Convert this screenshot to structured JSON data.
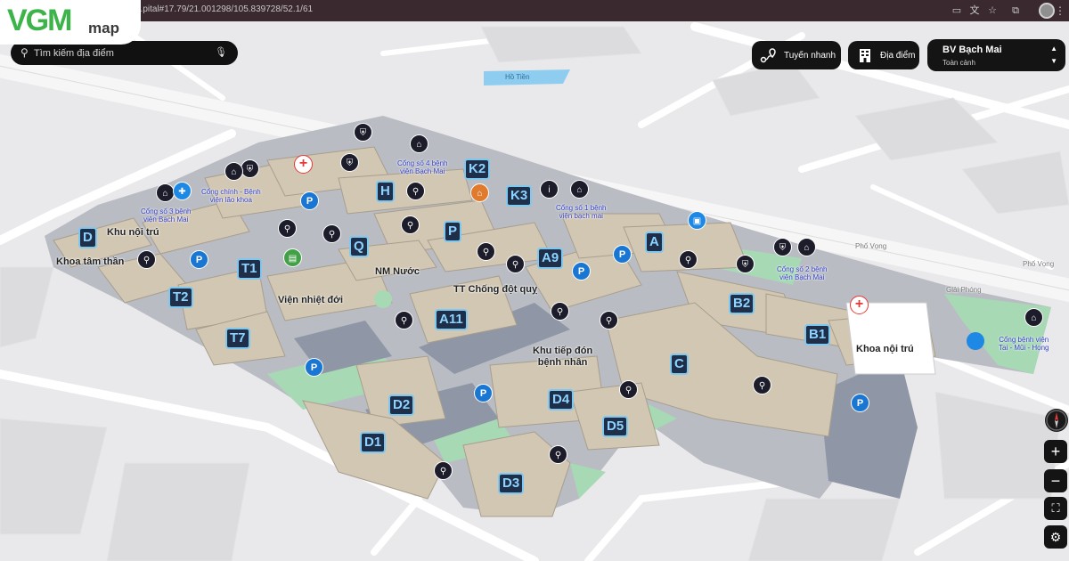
{
  "browser": {
    "url": "...pital#17.79/21.001298/105.839728/52.1/61"
  },
  "logo": {
    "mark": "VGM",
    "sub": "map"
  },
  "search": {
    "placeholder": "Tìm kiếm địa điểm"
  },
  "toolbar": {
    "route_label": "Tuyến nhanh",
    "places_label": "Địa điểm",
    "place_title": "BV Bạch Mai",
    "place_subtitle": "Toàn cảnh"
  },
  "controls": {
    "zoom_in": "+",
    "zoom_out": "−"
  },
  "map": {
    "streets": {
      "lake": "Hồ Tiền",
      "phuong_mai": "Phố Vọng",
      "phuong_mai_2": "Phố Vọng",
      "giai_phong": "Giải Phóng"
    },
    "areas": {
      "khu_noi_tru_left": "Khu nội trú",
      "khoa_tam_than": "Khoa tâm thần",
      "nm_nuoc": "NM Nước",
      "vien_nhiet_doi": "Viện nhiệt đới",
      "tt_chong_dot_quy": "TT Chống đột quỵ",
      "khu_tiep_don": "Khu tiếp đón\nbệnh nhân",
      "khoa_noi_tru_right": "Khoa nội trú"
    },
    "gates": {
      "cong_4": "Cổng số 4 bệnh\nviện Bạch Mai",
      "cong_chinh": "Cổng chính - Bệnh\nviện lão khoa",
      "cong_3": "Cổng số 3 bệnh\nviện Bạch Mai",
      "cong_1": "Cổng số 1 bệnh\nviện bạch mai",
      "cong_2": "Cổng số 2 bệnh\nviện Bạch Mai",
      "cong_tmh": "Cổng bệnh viện\nTai - Mũi - Họng"
    },
    "buildings": {
      "D": "D",
      "H": "H",
      "K2": "K2",
      "K3": "K3",
      "P": "P",
      "Q": "Q",
      "A": "A",
      "A9": "A9",
      "T1": "T1",
      "T2": "T2",
      "T7": "T7",
      "A11": "A11",
      "B2": "B2",
      "B1": "B1",
      "C": "C",
      "D2": "D2",
      "D4": "D4",
      "D5": "D5",
      "D1": "D1",
      "D3": "D3"
    },
    "pins": {
      "parking": "P",
      "hospital": "+"
    }
  }
}
